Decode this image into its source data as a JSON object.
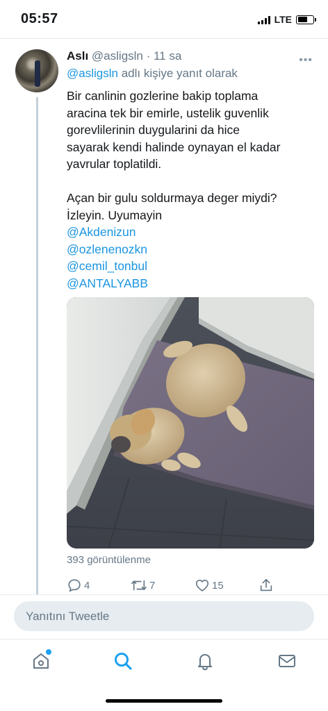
{
  "status_bar": {
    "time": "05:57",
    "network": "LTE"
  },
  "tweet": {
    "author_name": "Aslı",
    "handle": "@asligsln",
    "time_ago": "11 sa",
    "reply_to_handle": "@asligsln",
    "reply_to_suffix": "adlı kişiye yanıt olarak",
    "text_lines": [
      "Bir canlinin gozlerine bakip toplama",
      "aracina tek bir emirle, ustelik guvenlik",
      "gorevlilerinin duygularini da hice",
      "sayarak kendi halinde oynayan el kadar",
      "yavrular toplatildi."
    ],
    "text_lines_2": [
      "Açan bir gulu soldurmaya deger miydi?",
      "İzleyin. Uyumayin"
    ],
    "mentions": [
      "@Akdenizun",
      "@ozlenenozkn",
      "@cemil_tonbul",
      "@ANTALYABB"
    ],
    "views": "393 görüntülenme",
    "actions": {
      "replies": "4",
      "retweets": "7",
      "likes": "15"
    }
  },
  "reply_box": {
    "placeholder": "Yanıtını Tweetle"
  },
  "tab_bar": {
    "items": [
      "home-icon",
      "search-icon",
      "notifications-icon",
      "messages-icon"
    ],
    "active": "search-icon",
    "accent": "#1da1f2"
  }
}
